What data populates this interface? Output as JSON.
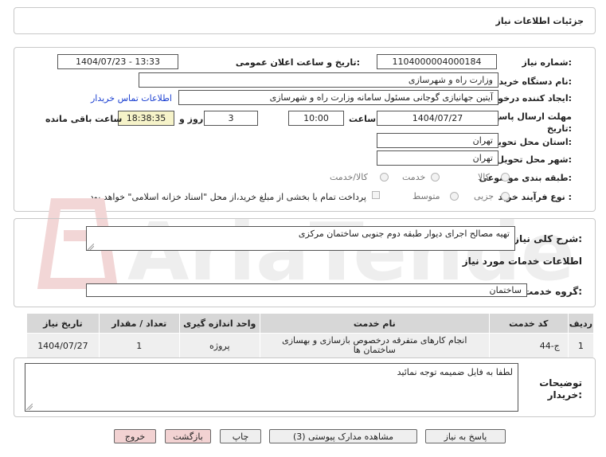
{
  "header": {
    "title": "جزئیات اطلاعات نیاز"
  },
  "form": {
    "need_number_label": "شماره نیاز:",
    "need_number": "1104000004000184",
    "announce_label": "تاریخ و ساعت اعلان عمومی:",
    "announce_value": "1404/07/23 - 13:33",
    "buyer_org_label": "نام دستگاه خریدار:",
    "buyer_org": "وزارت راه و شهرسازی",
    "creator_label": "ایجاد کننده درخواست:",
    "creator": "آیتین جهانیازی گوجانی مسئول سامانه وزارت راه و شهرسازی",
    "contact_link": "اطلاعات تماس خریدار",
    "deadline_label_1": "مهلت ارسال پاسخ: تا",
    "deadline_label_2": "تاریخ:",
    "deadline_date": "1404/07/27",
    "time_label": "ساعت",
    "deadline_time": "10:00",
    "days_value": "3",
    "days_label": "روز و",
    "remaining_time": "18:38:35",
    "remaining_label": "ساعت باقی مانده",
    "province_label": "استان محل تحویل:",
    "province": "تهران",
    "city_label": "شهر محل تحویل:",
    "city": "تهران",
    "category_label": "طبقه بندی موضوعی:",
    "category_options": [
      "کالا",
      "خدمت",
      "کالا/خدمت"
    ],
    "process_label": "نوع فرآیند خرید :",
    "process_options": [
      "جزیی",
      "متوسط"
    ],
    "payment_note": "پرداخت تمام یا بخشی از مبلغ خرید،از محل \"اسناد خزانه اسلامی\" خواهد بود."
  },
  "description": {
    "label": "شرح کلی نیاز:",
    "value": "تهیه مصالح اجرای دیوار طبقه دوم جنوبی ساختمان مرکزی"
  },
  "services": {
    "section_title": "اطلاعات خدمات مورد نیاز",
    "group_label": "گروه خدمت:",
    "group_value": "ساختمان",
    "columns": [
      "ردیف",
      "کد خدمت",
      "نام خدمت",
      "واحد اندازه گیری",
      "تعداد / مقدار",
      "تاریخ نیاز"
    ],
    "rows": [
      {
        "row": "1",
        "code": "ج-44",
        "name": "انجام کارهای متفرقه درخصوص بازسازی و بهسازی ساختمان ها",
        "unit": "پروژه",
        "qty": "1",
        "date": "1404/07/27"
      }
    ]
  },
  "buyer_notes": {
    "label_1": "توضیحات",
    "label_2": "خریدار:",
    "value": "لطفا به فایل ضمیمه توجه نمائید"
  },
  "buttons": {
    "reply": "پاسخ به نیاز",
    "documents": "مشاهده مدارک پیوستی (3)",
    "print": "چاپ",
    "back": "بازگشت",
    "exit": "خروج"
  },
  "colors": {
    "link": "#1a3fd1",
    "remaining_bg": "#f6f3c9",
    "panel_border": "#c8c8c8"
  }
}
